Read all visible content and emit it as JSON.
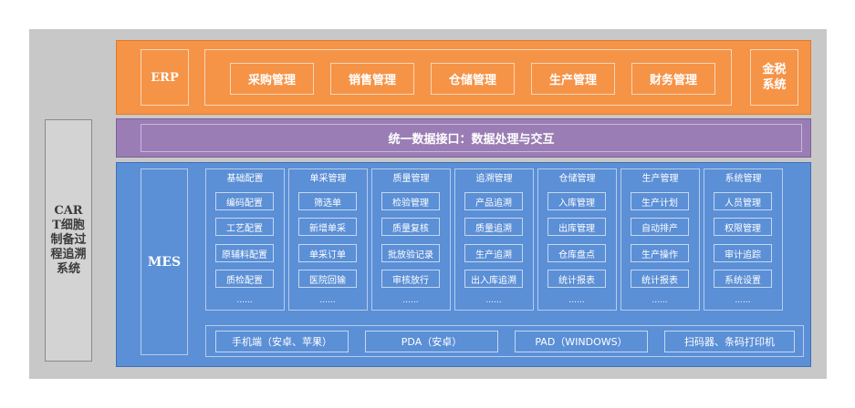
{
  "side_label": "CAR T细胞制备过程追溯系统",
  "erp": {
    "label": "ERP",
    "modules": [
      "采购管理",
      "销售管理",
      "仓储管理",
      "生产管理",
      "财务管理"
    ],
    "tax_line1": "金税",
    "tax_line2": "系统"
  },
  "interface": {
    "label": "统一数据接口：数据处理与交互"
  },
  "mes": {
    "label": "MES",
    "columns": [
      {
        "title": "基础配置",
        "items": [
          "编码配置",
          "工艺配置",
          "原辅料配置",
          "质检配置"
        ],
        "more": "......"
      },
      {
        "title": "单采管理",
        "items": [
          "筛选单",
          "新增单采",
          "单采订单",
          "医院回输"
        ],
        "more": "......"
      },
      {
        "title": "质量管理",
        "items": [
          "检验管理",
          "质量复核",
          "批放验记录",
          "审核放行"
        ],
        "more": "......"
      },
      {
        "title": "追溯管理",
        "items": [
          "产品追溯",
          "质量追溯",
          "生产追溯",
          "出入库追溯"
        ],
        "more": "......"
      },
      {
        "title": "仓储管理",
        "items": [
          "入库管理",
          "出库管理",
          "仓库盘点",
          "统计报表"
        ],
        "more": "......"
      },
      {
        "title": "生产管理",
        "items": [
          "生产计划",
          "自动排产",
          "生产操作",
          "统计报表"
        ],
        "more": "......"
      },
      {
        "title": "系统管理",
        "items": [
          "人员管理",
          "权限管理",
          "审计追踪",
          "系统设置"
        ],
        "more": "......"
      }
    ],
    "devices": [
      "手机端（安卓、苹果）",
      "PDA（安卓）",
      "PAD（WINDOWS）",
      "扫码器、条码打印机"
    ]
  },
  "colors": {
    "erp_layer": "#f59347",
    "interface_layer": "#9a7db5",
    "mes_layer": "#5b8fd6",
    "background": "#c8c8c8"
  }
}
